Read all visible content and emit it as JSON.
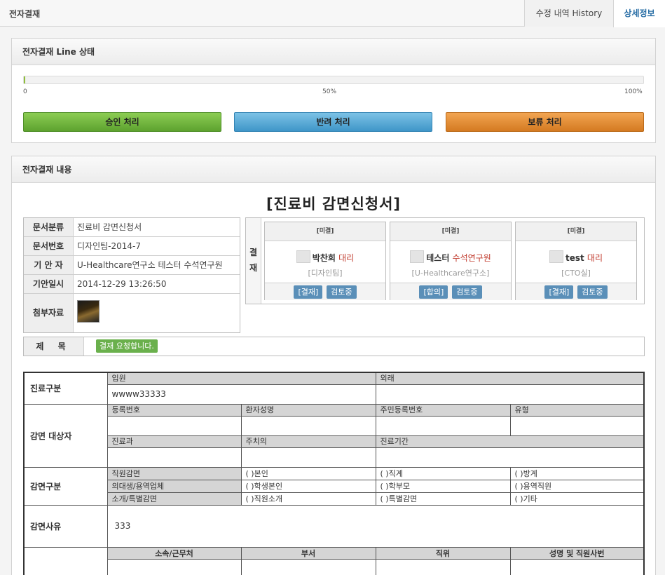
{
  "header": {
    "title": "전자결재",
    "tab_history": "수정 내역 History",
    "tab_detail": "상세정보"
  },
  "line_status": {
    "heading": "전자결재 Line 상태",
    "progress_percent": 1,
    "labels": [
      "0",
      "50%",
      "100%"
    ],
    "approve": "승인 처리",
    "reject": "반려 처리",
    "hold": "보류 처리"
  },
  "content": {
    "heading": "전자결재 내용",
    "doc_title": "[진료비 감면신청서]",
    "info": [
      {
        "k": "문서분류",
        "v": "진료비 감면신청서"
      },
      {
        "k": "문서번호",
        "v": "디자인팀-2014-7"
      },
      {
        "k": "기 안 자",
        "v": "U-Healthcare연구소 테스터 수석연구원"
      },
      {
        "k": "기안일시",
        "v": "2014-12-29 13:26:50"
      },
      {
        "k": "첨부자료",
        "v": ""
      }
    ],
    "approval_label": "결 재",
    "approvers": [
      {
        "status": "[미결]",
        "name": "박찬희",
        "rank": "대리",
        "dept": "[디자인팀]",
        "btn1": "[결재]",
        "btn2": "검토중"
      },
      {
        "status": "[미결]",
        "name": "테스터",
        "rank": "수석연구원",
        "dept": "[U-Healthcare연구소]",
        "btn1": "[합의]",
        "btn2": "검토중"
      },
      {
        "status": "[미결]",
        "name": "test",
        "rank": "대리",
        "dept": "[CTO실]",
        "btn1": "[결재]",
        "btn2": "검토중"
      }
    ],
    "subject_label": "제 목",
    "subject": "결재 요청합니다."
  },
  "form": {
    "treat_label": "진료구분",
    "inpatient": "입원",
    "outpatient": "외래",
    "treat_value": "wwww33333",
    "target_label": "감면 대상자",
    "reg_no": "등록번호",
    "patient_name": "환자성명",
    "resident_no": "주민등록번호",
    "type": "유형",
    "department": "진료과",
    "doctor": "주치의",
    "period": "진료기간",
    "reduction_label": "감면구분",
    "rows": [
      [
        "직원감면",
        "( )본인",
        "( )직계",
        "( )방계"
      ],
      [
        "의대생/용역업체",
        "( )학생본인",
        "( )학부모",
        "( )용역직원"
      ],
      [
        "소개/특별감면",
        "( )직원소개",
        "( )특별감면",
        "( )기타"
      ]
    ],
    "reason_label": "감면사유",
    "reason_value": "333",
    "affiliation": "소속/근무처",
    "dept2": "부서",
    "position": "직위",
    "name_id": "성명 및 직원사번"
  }
}
